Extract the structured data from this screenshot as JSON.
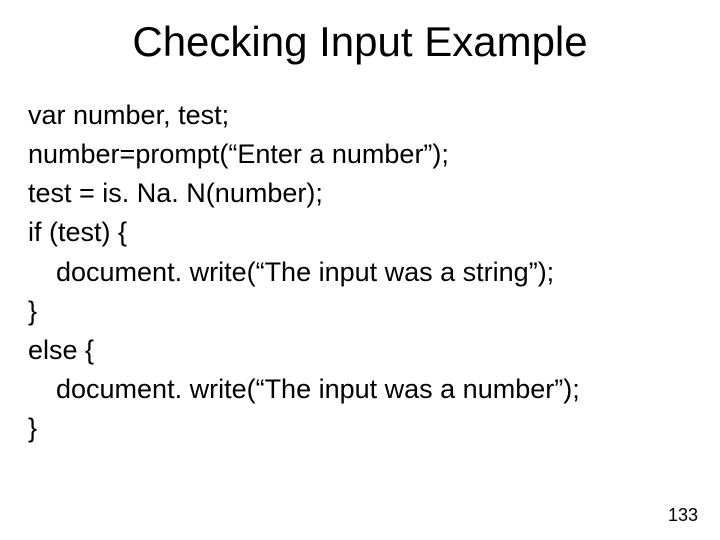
{
  "title": "Checking Input Example",
  "code": {
    "l1": "var number, test;",
    "l2": "number=prompt(“Enter a number”);",
    "l3": "test = is. Na. N(number);",
    "l4": "if (test) {",
    "l5": "document. write(“The input was a string”);",
    "l6": "}",
    "l7": "else {",
    "l8": "document. write(“The input was a number”);",
    "l9": "}"
  },
  "page_number": "133"
}
